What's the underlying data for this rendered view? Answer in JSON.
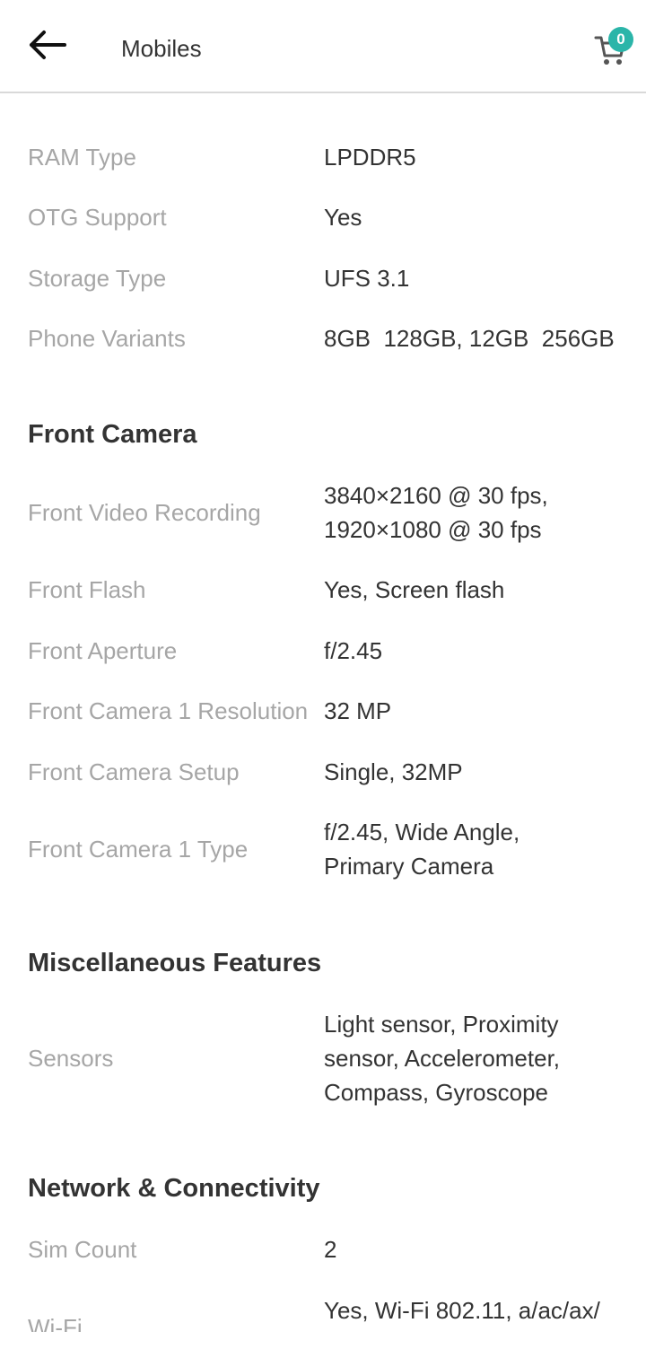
{
  "header": {
    "title": "Mobiles",
    "back_icon": "arrow-left-icon",
    "cart_icon": "cart-icon",
    "cart_count": "0",
    "accent_color": "#2bb5a9"
  },
  "memory": {
    "rows": [
      {
        "label": "RAM Type",
        "value": "LPDDR5"
      },
      {
        "label": "OTG Support",
        "value": "Yes"
      },
      {
        "label": "Storage Type",
        "value": "UFS 3.1"
      },
      {
        "label": "Phone Variants",
        "value": "8GB  128GB, 12GB  256GB"
      }
    ]
  },
  "front_camera": {
    "title": "Front Camera",
    "rows": [
      {
        "label": "Front Video Recording",
        "value_lines": [
          "3840×2160 @ 30 fps,",
          "1920×1080 @ 30 fps"
        ]
      },
      {
        "label": "Front Flash",
        "value": "Yes, Screen flash"
      },
      {
        "label": "Front Aperture",
        "value": "f/2.45"
      },
      {
        "label": "Front Camera 1 Resolution",
        "value": "32 MP"
      },
      {
        "label": "Front Camera Setup",
        "value": "Single, 32MP"
      },
      {
        "label": "Front Camera 1 Type",
        "value_lines": [
          "f/2.45, Wide Angle,",
          "Primary Camera"
        ]
      }
    ]
  },
  "misc": {
    "title": "Miscellaneous Features",
    "rows": [
      {
        "label": "Sensors",
        "value_lines": [
          "Light sensor, Proximity",
          "sensor, Accelerometer,",
          "Compass, Gyroscope"
        ]
      }
    ]
  },
  "network": {
    "title": "Network & Connectivity",
    "rows": [
      {
        "label": "Sim Count",
        "value": "2"
      },
      {
        "label": "Wi-Fi",
        "value": "Yes, Wi-Fi 802.11, a/ac/ax/"
      }
    ]
  }
}
